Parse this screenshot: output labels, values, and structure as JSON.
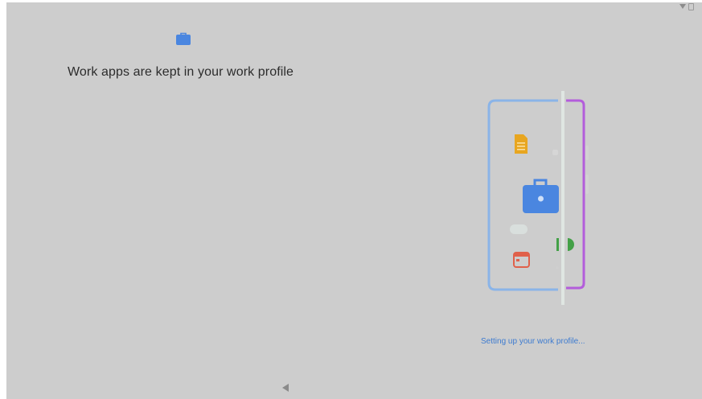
{
  "screen": {
    "title": "Work apps are kept in your work profile",
    "status_message": "Setting up your work profile...",
    "header_icon": "briefcase-icon"
  },
  "status_bar": {
    "icons": [
      "wifi-icon",
      "battery-icon"
    ]
  },
  "illustration": {
    "icons": [
      "document-icon",
      "briefcase-icon",
      "calendar-icon",
      "phone-icon"
    ]
  },
  "navigation": {
    "icons": [
      "back-icon"
    ]
  },
  "colors": {
    "accent_blue": "#3d7bd0",
    "briefcase_blue": "#4a86e0",
    "document_yellow": "#e8a620",
    "calendar_red": "#e0604a",
    "phone_green": "#43a047",
    "work_profile_purple": "#b35ddb",
    "device_outline_blue": "#8ab4e8"
  }
}
